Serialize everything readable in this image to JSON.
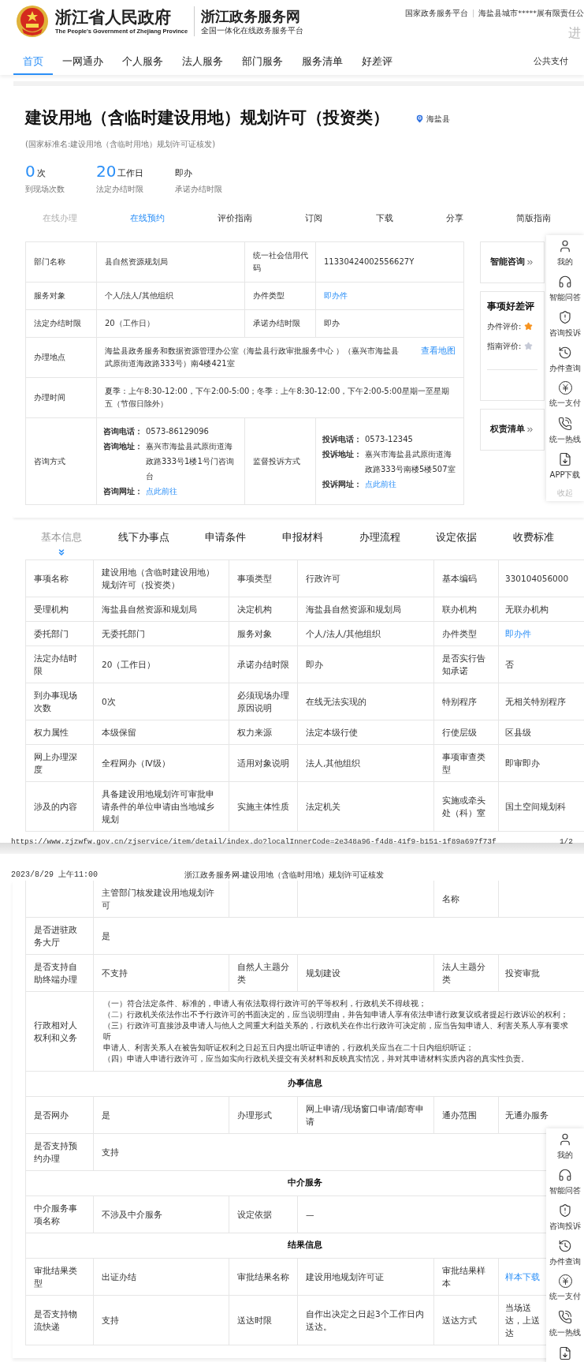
{
  "header": {
    "gov_name": "浙江省人民政府",
    "gov_name_en": "The People's Government of Zhejiang Province",
    "site_name": "浙江政务服务网",
    "site_tagline": "全国一体化在线政务服务平台",
    "top_links": [
      "国家政务服务平台",
      "海盐县城市*****展有限责任公"
    ],
    "right_text": "进"
  },
  "nav": [
    {
      "label": "首页",
      "selected": true
    },
    {
      "label": "一网通办",
      "selected": false
    },
    {
      "label": "个人服务",
      "selected": false
    },
    {
      "label": "法人服务",
      "selected": false
    },
    {
      "label": "部门服务",
      "selected": false
    },
    {
      "label": "服务清单",
      "selected": false
    },
    {
      "label": "好差评",
      "selected": false
    }
  ],
  "nav_right": "公共支付",
  "item": {
    "title": "建设用地（含临时建设用地）规划许可（投资类）",
    "location": "海盐县",
    "standard_name": "(国家标准名:建设用地（含临时用地）规划许可证核发)",
    "stats": [
      {
        "kind": "count",
        "value": "0",
        "unit": "次",
        "label": "到现场次数"
      },
      {
        "kind": "count",
        "value": "20",
        "unit": "工作日",
        "label": "法定办结时限"
      },
      {
        "kind": "text",
        "text": "即办",
        "label": "承诺办结时限"
      }
    ],
    "actions": [
      {
        "label": "在线办理",
        "disabled": true,
        "active": false
      },
      {
        "label": "在线预约",
        "disabled": false,
        "active": true
      },
      {
        "label": "评价指南",
        "disabled": false,
        "active": false
      },
      {
        "label": "订阅",
        "disabled": false,
        "active": false
      },
      {
        "label": "下载",
        "disabled": false,
        "active": false
      },
      {
        "label": "分享",
        "disabled": false,
        "active": false
      },
      {
        "label": "简版指南",
        "disabled": false,
        "active": false
      }
    ]
  },
  "info_table": {
    "rows": [
      {
        "cells": [
          {
            "kind": "label",
            "text": "部门名称"
          },
          {
            "kind": "value",
            "text": "县自然资源规划局"
          },
          {
            "kind": "label",
            "text": "统一社会信用代码"
          },
          {
            "kind": "value",
            "text": "11330424002556627Y"
          }
        ]
      },
      {
        "cells": [
          {
            "kind": "label",
            "text": "服务对象"
          },
          {
            "kind": "value",
            "text": "个人/法人/其他组织"
          },
          {
            "kind": "label",
            "text": "办件类型"
          },
          {
            "kind": "link",
            "text": "即办件"
          }
        ]
      },
      {
        "cells": [
          {
            "kind": "label",
            "text": "法定办结时限"
          },
          {
            "kind": "value",
            "text": "20（工作日）"
          },
          {
            "kind": "label",
            "text": "承诺办结时限"
          },
          {
            "kind": "value",
            "text": "即办"
          }
        ]
      },
      {
        "cells": [
          {
            "kind": "label",
            "text": "办理地点"
          },
          {
            "kind": "address",
            "text": "海盐县政务服务和数据资源管理办公室（海盐县行政审批服务中心 ）（嘉兴市海盐县武原街道海政路333号）南4楼421室",
            "link": "查看地图"
          }
        ]
      },
      {
        "cells": [
          {
            "kind": "label",
            "text": "办理时间"
          },
          {
            "kind": "value",
            "text": "夏季：上午8:30-12:00，下午2:00-5:00；冬季：上午8:30-12:00，下午2:00-5:00星期一至星期五（节假日除外）"
          }
        ]
      },
      {
        "cells": [
          {
            "kind": "label",
            "text": "咨询方式"
          },
          {
            "kind": "contact",
            "lines": [
              {
                "label": "咨询电话：",
                "value": "0573-86129096",
                "link": false
              },
              {
                "label": "咨询地址：",
                "value": "嘉兴市海盐县武原街道海政路333号1楼1号门咨询台",
                "link": false
              },
              {
                "label": "咨询网址：",
                "value": "点此前往",
                "link": true
              }
            ]
          },
          {
            "kind": "label",
            "text": "监督投诉方式"
          },
          {
            "kind": "contact",
            "lines": [
              {
                "label": "投诉电话：",
                "value": "0573-12345",
                "link": false
              },
              {
                "label": "投诉地址：",
                "value": "嘉兴市海盐县武原街道海政路333号南楼5楼507室",
                "link": false
              },
              {
                "label": "投诉网址：",
                "value": "点此前往",
                "link": true
              }
            ]
          }
        ]
      }
    ]
  },
  "side_cards": [
    {
      "kind": "link",
      "title": "智能咨询"
    },
    {
      "kind": "rating",
      "title": "事项好差评",
      "ratings": [
        {
          "label": "办件评价:",
          "rated": true
        },
        {
          "label": "指南评价:",
          "rated": false
        }
      ]
    },
    {
      "kind": "link",
      "title": "权责清单"
    }
  ],
  "sidebar": {
    "items": [
      {
        "label": "我的"
      },
      {
        "label": "智能问答"
      },
      {
        "label": "咨询投诉"
      },
      {
        "label": "办件查询"
      },
      {
        "label": "统一支付"
      },
      {
        "label": "统一热线"
      },
      {
        "label": "APP下载"
      }
    ],
    "collapse": "收起"
  },
  "detail_tabs": [
    {
      "label": "基本信息",
      "selected": true
    },
    {
      "label": "线下办事点",
      "selected": false
    },
    {
      "label": "申请条件",
      "selected": false
    },
    {
      "label": "申报材料",
      "selected": false
    },
    {
      "label": "办理流程",
      "selected": false
    },
    {
      "label": "设定依据",
      "selected": false
    },
    {
      "label": "收费标准",
      "selected": false
    }
  ],
  "detail_table_page1": {
    "rows": [
      {
        "cells": [
          {
            "kind": "label",
            "text": "事项名称"
          },
          {
            "kind": "value",
            "text": "建设用地（含临时建设用地）规划许可（投资类）"
          },
          {
            "kind": "label",
            "text": "事项类型"
          },
          {
            "kind": "value",
            "text": "行政许可"
          },
          {
            "kind": "label",
            "text": "基本编码"
          },
          {
            "kind": "value",
            "text": "330104056000"
          }
        ]
      },
      {
        "cells": [
          {
            "kind": "label",
            "text": "受理机构"
          },
          {
            "kind": "value",
            "text": "海盐县自然资源和规划局"
          },
          {
            "kind": "label",
            "text": "决定机构"
          },
          {
            "kind": "value",
            "text": "海盐县自然资源和规划局"
          },
          {
            "kind": "label",
            "text": "联办机构"
          },
          {
            "kind": "value",
            "text": "无联办机构"
          }
        ]
      },
      {
        "cells": [
          {
            "kind": "label",
            "text": "委托部门"
          },
          {
            "kind": "value",
            "text": "无委托部门"
          },
          {
            "kind": "label",
            "text": "服务对象"
          },
          {
            "kind": "value",
            "text": "个人/法人/其他组织"
          },
          {
            "kind": "label",
            "text": "办件类型"
          },
          {
            "kind": "link",
            "text": "即办件"
          }
        ]
      },
      {
        "cells": [
          {
            "kind": "label",
            "text": "法定办结时限"
          },
          {
            "kind": "value",
            "text": "20（工作日）"
          },
          {
            "kind": "label",
            "text": "承诺办结时限"
          },
          {
            "kind": "value",
            "text": "即办"
          },
          {
            "kind": "label",
            "text": "是否实行告知承诺"
          },
          {
            "kind": "value",
            "text": "否"
          }
        ]
      },
      {
        "cells": [
          {
            "kind": "label",
            "text": "到办事现场次数"
          },
          {
            "kind": "value",
            "text": "0次"
          },
          {
            "kind": "label",
            "text": "必须现场办理原因说明"
          },
          {
            "kind": "value",
            "text": "在线无法实现的"
          },
          {
            "kind": "label",
            "text": "特别程序"
          },
          {
            "kind": "value",
            "text": "无相关特别程序"
          }
        ]
      },
      {
        "cells": [
          {
            "kind": "label",
            "text": "权力属性"
          },
          {
            "kind": "value",
            "text": "本级保留"
          },
          {
            "kind": "label",
            "text": "权力来源"
          },
          {
            "kind": "value",
            "text": "法定本级行使"
          },
          {
            "kind": "label",
            "text": "行使层级"
          },
          {
            "kind": "value",
            "text": "区县级"
          }
        ]
      },
      {
        "cells": [
          {
            "kind": "label",
            "text": "网上办理深度"
          },
          {
            "kind": "value",
            "text": "全程网办（Ⅳ级）"
          },
          {
            "kind": "label",
            "text": "适用对象说明"
          },
          {
            "kind": "value",
            "text": "法人,其他组织"
          },
          {
            "kind": "label",
            "text": "事项审查类型"
          },
          {
            "kind": "value",
            "text": "即审即办"
          }
        ]
      },
      {
        "cells": [
          {
            "kind": "label",
            "text": "涉及的内容"
          },
          {
            "kind": "value",
            "text": "具备建设用地规划许可审批申请条件的单位申请由当地城乡规划"
          },
          {
            "kind": "label",
            "text": "实施主体性质"
          },
          {
            "kind": "value",
            "text": "法定机关"
          },
          {
            "kind": "label",
            "text": "实施或牵头处（科）室"
          },
          {
            "kind": "value",
            "text": "国土空间规划科"
          }
        ]
      }
    ]
  },
  "print_footer": {
    "url": "https://www.zjzwfw.gov.cn/zjservice/item/detail/index.do?localInnerCode=2e348a96-f4d8-41f9-b151-1f89a697f73f",
    "page": "1/2"
  },
  "print_header": {
    "date": "2023/8/29 上午11:00",
    "title": "浙江政务服务网-建设用地（含临时用地）规划许可证核发"
  },
  "detail_table_page2": {
    "sections": [
      {
        "rows": [
          {
            "cells": [
              {
                "kind": "empty"
              },
              {
                "kind": "value",
                "text": "主管部门核发建设用地规划许可"
              },
              {
                "kind": "empty"
              },
              {
                "kind": "empty"
              },
              {
                "kind": "label",
                "text": "名称"
              },
              {
                "kind": "empty"
              }
            ]
          },
          {
            "cells": [
              {
                "kind": "label",
                "text": "是否进驻政务大厅"
              },
              {
                "kind": "value",
                "text": "是"
              }
            ]
          },
          {
            "cells": [
              {
                "kind": "label",
                "text": "是否支持自助终端办理"
              },
              {
                "kind": "value",
                "text": "不支持"
              },
              {
                "kind": "label",
                "text": "自然人主题分类"
              },
              {
                "kind": "value",
                "text": "规划建设"
              },
              {
                "kind": "label",
                "text": "法人主题分类"
              },
              {
                "kind": "value",
                "text": "投资审批"
              }
            ]
          },
          {
            "cells": [
              {
                "kind": "label",
                "text": "行政相对人权利和义务"
              },
              {
                "kind": "lines",
                "lines": [
                  "（一）符合法定条件、标准的，申请人有依法取得行政许可的平等权利，行政机关不得歧视；",
                  "（二）行政机关依法作出不予行政许可的书面决定的，应当说明理由，并告知申请人享有依法申请行政复议或者提起行政诉讼的权利；",
                  "（三）行政许可直接涉及申请人与他人之间重大利益关系的，行政机关在作出行政许可决定前，应当告知申请人、利害关系人享有要求听",
                  "申请人、利害关系人在被告知听证权利之日起五日内提出听证申请的，行政机关应当在二十日内组织听证；",
                  "（四）申请人申请行政许可，应当如实向行政机关提交有关材料和反映真实情况，并对其申请材料实质内容的真实性负责。"
                ]
              }
            ]
          }
        ]
      },
      {
        "heading": "办事信息",
        "rows": [
          {
            "cells": [
              {
                "kind": "label",
                "text": "是否网办"
              },
              {
                "kind": "value",
                "text": "是"
              },
              {
                "kind": "label",
                "text": "办理形式"
              },
              {
                "kind": "value",
                "text": "网上申请/现场窗口申请/邮寄申请"
              },
              {
                "kind": "label",
                "text": "通办范围"
              },
              {
                "kind": "value",
                "text": "无通办服务"
              }
            ]
          },
          {
            "cells": [
              {
                "kind": "label",
                "text": "是否支持预约办理"
              },
              {
                "kind": "value",
                "text": "支持"
              }
            ]
          }
        ]
      },
      {
        "heading": "中介服务",
        "rows": [
          {
            "cells": [
              {
                "kind": "label",
                "text": "中介服务事项名称"
              },
              {
                "kind": "value",
                "text": "不涉及中介服务"
              },
              {
                "kind": "label",
                "text": "设定依据"
              },
              {
                "kind": "value",
                "text": "—"
              }
            ]
          }
        ]
      },
      {
        "heading": "结果信息",
        "rows": [
          {
            "cells": [
              {
                "kind": "label",
                "text": "审批结果类型"
              },
              {
                "kind": "value",
                "text": "出证办结"
              },
              {
                "kind": "label",
                "text": "审批结果名称"
              },
              {
                "kind": "value",
                "text": "建设用地规划许可证"
              },
              {
                "kind": "label",
                "text": "审批结果样本"
              },
              {
                "kind": "link",
                "text": "样本下载"
              }
            ]
          },
          {
            "cells": [
              {
                "kind": "label",
                "text": "是否支持物流快递"
              },
              {
                "kind": "value",
                "text": "支持"
              },
              {
                "kind": "label",
                "text": "送达时限"
              },
              {
                "kind": "value",
                "text": "自作出决定之日起3个工作日内送达。"
              },
              {
                "kind": "label",
                "text": "送达方式"
              },
              {
                "kind": "value",
                "text": "当场送达，上送达"
              }
            ]
          }
        ]
      }
    ]
  },
  "sidebar_2": {
    "items": [
      {
        "label": "我的"
      },
      {
        "label": "智能问答"
      },
      {
        "label": "咨询投诉"
      },
      {
        "label": "办件查询"
      },
      {
        "label": "统一支付"
      },
      {
        "label": "统一热线"
      }
    ]
  }
}
